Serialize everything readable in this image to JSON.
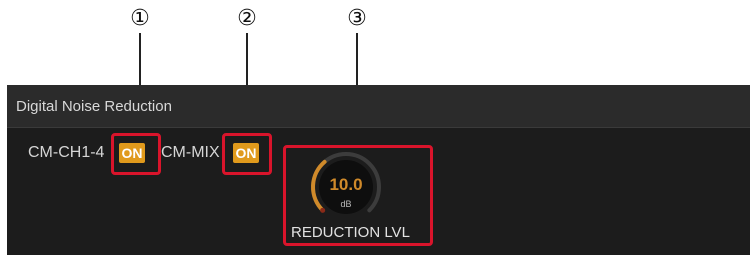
{
  "callouts": [
    "①",
    "②",
    "③"
  ],
  "panel": {
    "title": "Digital Noise Reduction"
  },
  "switches": [
    {
      "label": "CM-CH1-4",
      "state": "ON"
    },
    {
      "label": "CM-MIX",
      "state": "ON"
    }
  ],
  "knob": {
    "value": "10.0",
    "unit": "dB",
    "label": "REDUCTION LVL",
    "level_fraction": 0.35
  },
  "colors": {
    "on_button": "#e09a1c",
    "highlight": "#d9142b",
    "panel_bg": "#1c1c1c",
    "knob_arc": "#d08a2a"
  }
}
